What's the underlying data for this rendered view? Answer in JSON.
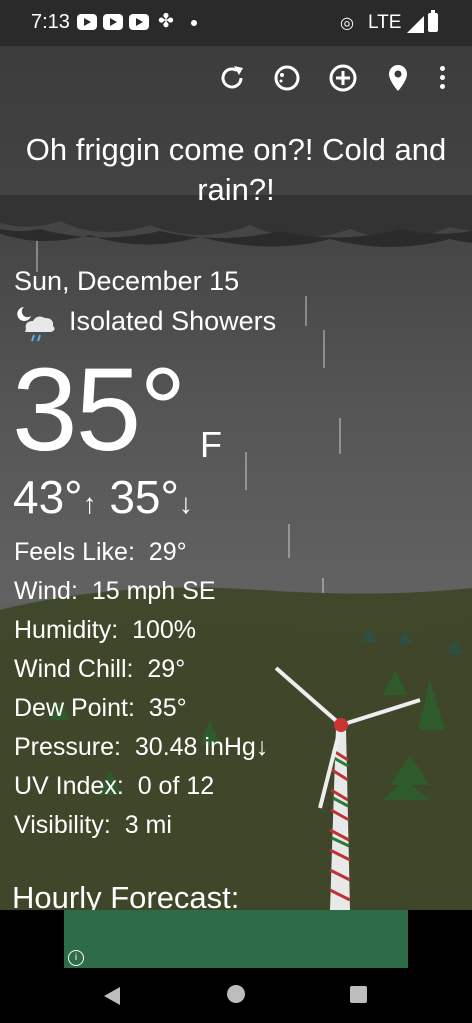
{
  "status_bar": {
    "time": "7:13",
    "network": "LTE"
  },
  "toolbar": {
    "icons": [
      "refresh-icon",
      "theme-icon",
      "add-location-icon",
      "location-pin-icon",
      "more-vert-icon"
    ]
  },
  "headline": "Oh friggin come on?! Cold and rain?!",
  "current": {
    "date": "Sun, December 15",
    "condition": "Isolated Showers",
    "condition_icon": "moon-cloud-rain-icon",
    "temperature": "35°",
    "unit": "F",
    "high": "43°",
    "low": "35°"
  },
  "details": [
    {
      "label": "Feels Like:",
      "value": "29°"
    },
    {
      "label": "Wind:",
      "value": "15 mph SE"
    },
    {
      "label": "Humidity:",
      "value": "100%"
    },
    {
      "label": "Wind Chill:",
      "value": "29°"
    },
    {
      "label": "Dew Point:",
      "value": "35°"
    },
    {
      "label": "Pressure:",
      "value": "30.48 inHg↓"
    },
    {
      "label": "UV Index:",
      "value": "0 of 12"
    },
    {
      "label": "Visibility:",
      "value": "3 mi"
    }
  ],
  "hourly_heading": "Hourly Forecast:",
  "ad": {
    "info": "i"
  },
  "colors": {
    "ad": "#2e6b47",
    "sky": "#444444",
    "ground": "#3d4528"
  }
}
